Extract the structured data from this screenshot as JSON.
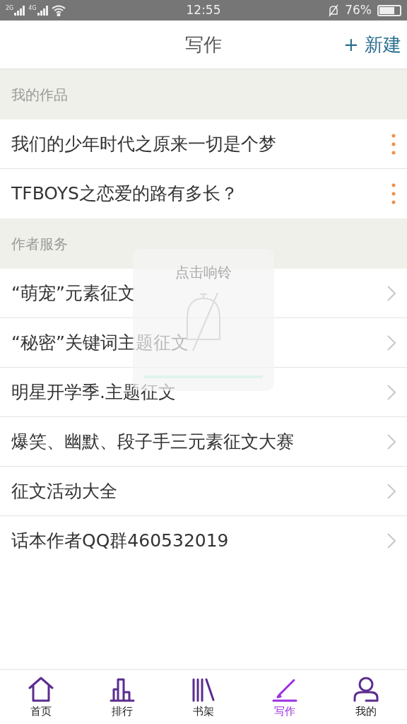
{
  "status_bar": {
    "network_labels": [
      "2G",
      "4G"
    ],
    "time": "12:55",
    "battery": "76%"
  },
  "header": {
    "title": "写作",
    "new_button": "+ 新建"
  },
  "sections": [
    {
      "title": "我的作品",
      "kind": "works",
      "items": [
        {
          "title": "我们的少年时代之原来一切是个梦"
        },
        {
          "title": "TFBOYS之恋爱的路有多长？"
        }
      ]
    },
    {
      "title": "作者服务",
      "kind": "services",
      "items": [
        {
          "title": "“萌宠”元素征文"
        },
        {
          "title": "“秘密”关键词主题征文"
        },
        {
          "title": "明星开学季.主题征文"
        },
        {
          "title": "爆笑、幽默、段子手三元素征文大赛"
        },
        {
          "title": "征文活动大全"
        },
        {
          "title": "话本作者QQ群460532019"
        }
      ]
    }
  ],
  "toast": {
    "text": "点击响铃"
  },
  "nav": [
    {
      "label": "首页",
      "kind": "home",
      "selected": false
    },
    {
      "label": "排行",
      "kind": "rank",
      "selected": false
    },
    {
      "label": "书架",
      "kind": "shelf",
      "selected": false
    },
    {
      "label": "写作",
      "kind": "write",
      "selected": true
    },
    {
      "label": "我的",
      "kind": "me",
      "selected": false
    }
  ]
}
